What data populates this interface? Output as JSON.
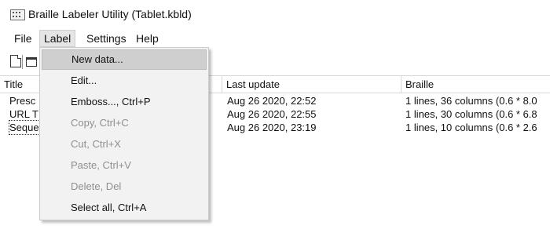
{
  "window": {
    "title": "Braille Labeler Utility (Tablet.kbld)",
    "icon": "braille-app-icon"
  },
  "menubar": {
    "items": [
      {
        "label": "File"
      },
      {
        "label": "Label"
      },
      {
        "label": "Settings"
      },
      {
        "label": "Help"
      }
    ],
    "open_menu": "Label"
  },
  "toolbar": {
    "buttons": [
      {
        "icon": "new-document-icon"
      },
      {
        "icon": "open-folder-icon"
      }
    ]
  },
  "table": {
    "columns": [
      "Title",
      "Last update",
      "Braille"
    ],
    "rows": [
      {
        "title": "Presc",
        "last_update": "Aug 26 2020, 22:52",
        "braille": "1 lines, 36 columns (0.6 * 8.0"
      },
      {
        "title": "URL T",
        "last_update": "Aug 26 2020, 22:55",
        "braille": "1 lines, 30 columns (0.6 * 6.8"
      },
      {
        "title": "Seque",
        "last_update": "Aug 26 2020, 23:19",
        "braille": "1 lines, 10 columns (0.6 * 2.6"
      }
    ]
  },
  "label_menu": {
    "items": [
      {
        "label": "New data...",
        "state": "highlighted"
      },
      {
        "label": "Edit...",
        "state": "enabled"
      },
      {
        "label": "Emboss..., Ctrl+P",
        "state": "enabled"
      },
      {
        "label": "Copy, Ctrl+C",
        "state": "disabled"
      },
      {
        "label": "Cut, Ctrl+X",
        "state": "disabled"
      },
      {
        "label": "Paste, Ctrl+V",
        "state": "disabled"
      },
      {
        "label": "Delete, Del",
        "state": "disabled"
      },
      {
        "label": "Select all, Ctrl+A",
        "state": "enabled"
      }
    ]
  },
  "colors": {
    "menu_background": "#f2f2f2",
    "menu_highlight": "#cfcfcf",
    "disabled_text": "#8f8f8f"
  }
}
